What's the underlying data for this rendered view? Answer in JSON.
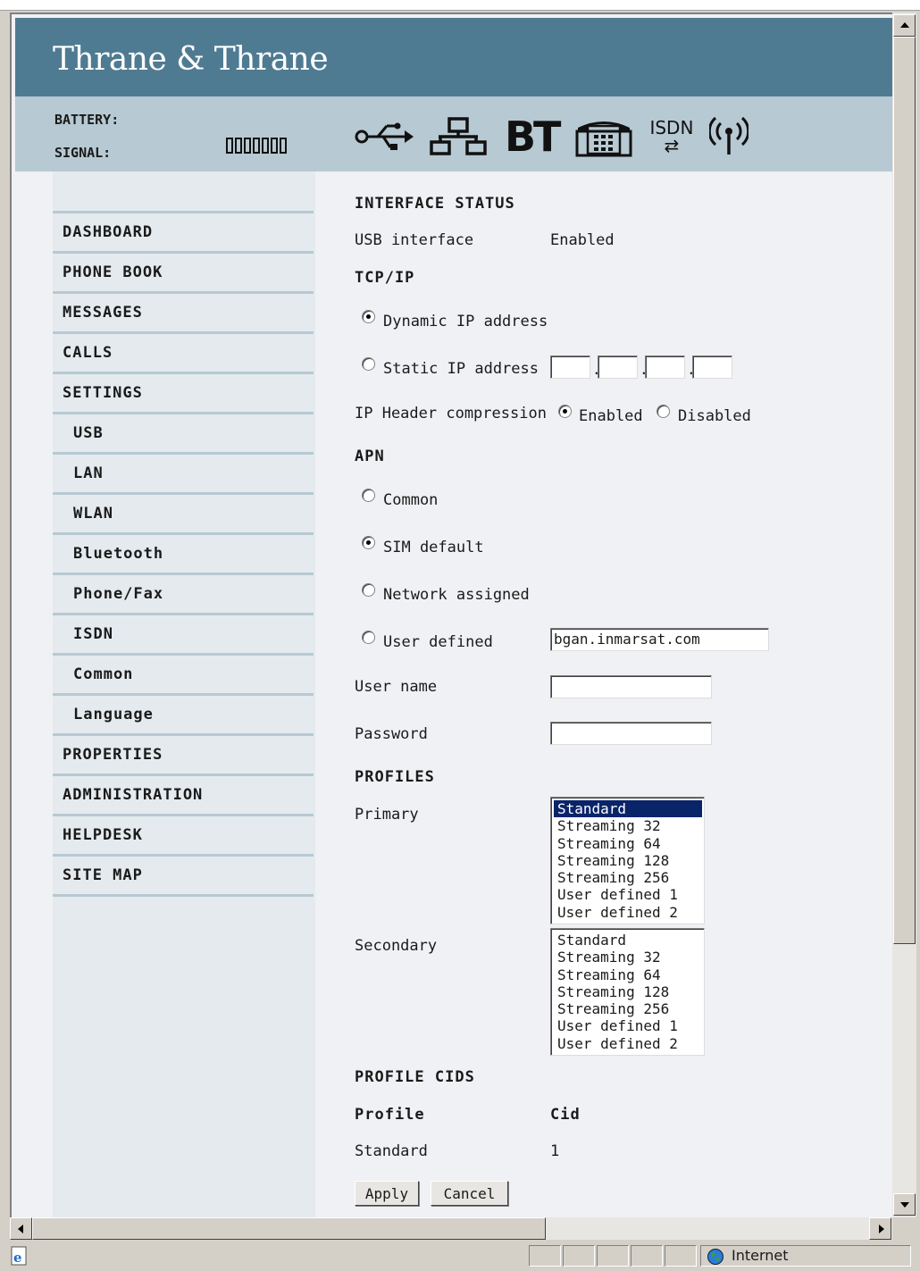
{
  "brand": {
    "logo": "Thrane & Thrane"
  },
  "status": {
    "battery_label": "BATTERY:",
    "signal_label": "SIGNAL:",
    "signal_level": 0,
    "icons": [
      "usb-icon",
      "lan-icon",
      "bluetooth-icon",
      "phone-fax-icon",
      "isdn-icon",
      "wlan-icon"
    ],
    "bt_text": "BT",
    "isdn_text": "ISDN"
  },
  "nav": {
    "items": [
      {
        "label": "DASHBOARD",
        "sub": false
      },
      {
        "label": "PHONE BOOK",
        "sub": false
      },
      {
        "label": "MESSAGES",
        "sub": false
      },
      {
        "label": "CALLS",
        "sub": false
      },
      {
        "label": "SETTINGS",
        "sub": false
      },
      {
        "label": "USB",
        "sub": true
      },
      {
        "label": "LAN",
        "sub": true
      },
      {
        "label": "WLAN",
        "sub": true
      },
      {
        "label": "Bluetooth",
        "sub": true
      },
      {
        "label": "Phone/Fax",
        "sub": true
      },
      {
        "label": "ISDN",
        "sub": true
      },
      {
        "label": "Common",
        "sub": true
      },
      {
        "label": "Language",
        "sub": true
      },
      {
        "label": "PROPERTIES",
        "sub": false
      },
      {
        "label": "ADMINISTRATION",
        "sub": false
      },
      {
        "label": "HELPDESK",
        "sub": false
      },
      {
        "label": "SITE MAP",
        "sub": false
      }
    ]
  },
  "form": {
    "interface_status_heading": "INTERFACE STATUS",
    "usb_interface_label": "USB interface",
    "usb_interface_value": "Enabled",
    "tcpip_heading": "TCP/IP",
    "dynamic_ip_label": "Dynamic IP address",
    "static_ip_label": "Static IP address",
    "static_ip_octets": [
      "",
      "",
      "",
      ""
    ],
    "ip_header_label": "IP Header compression",
    "enabled_label": "Enabled",
    "disabled_label": "Disabled",
    "apn_heading": "APN",
    "apn_common_label": "Common",
    "apn_sim_default_label": "SIM default",
    "apn_network_label": "Network assigned",
    "apn_user_defined_label": "User defined",
    "apn_user_defined_value": "bgan.inmarsat.com",
    "user_name_label": "User name",
    "user_name_value": "",
    "password_label": "Password",
    "password_value": "",
    "profiles_heading": "PROFILES",
    "primary_label": "Primary",
    "secondary_label": "Secondary",
    "profile_options": [
      "Standard",
      "Streaming 32",
      "Streaming 64",
      "Streaming 128",
      "Streaming 256",
      "User defined 1",
      "User defined 2"
    ],
    "primary_selected": "Standard",
    "profile_cids_heading": "PROFILE CIDS",
    "cid_col_profile": "Profile",
    "cid_col_cid": "Cid",
    "cid_rows": [
      {
        "profile": "Standard",
        "cid": "1"
      }
    ],
    "apply_label": "Apply",
    "cancel_label": "Cancel"
  },
  "browser": {
    "zone_label": "Internet"
  },
  "colors": {
    "header": "#4f7b92",
    "statusbar": "#b7c9d2",
    "nav_bg": "#e4eaee",
    "content_bg": "#f0f1f4",
    "selected": "#0a246a"
  }
}
